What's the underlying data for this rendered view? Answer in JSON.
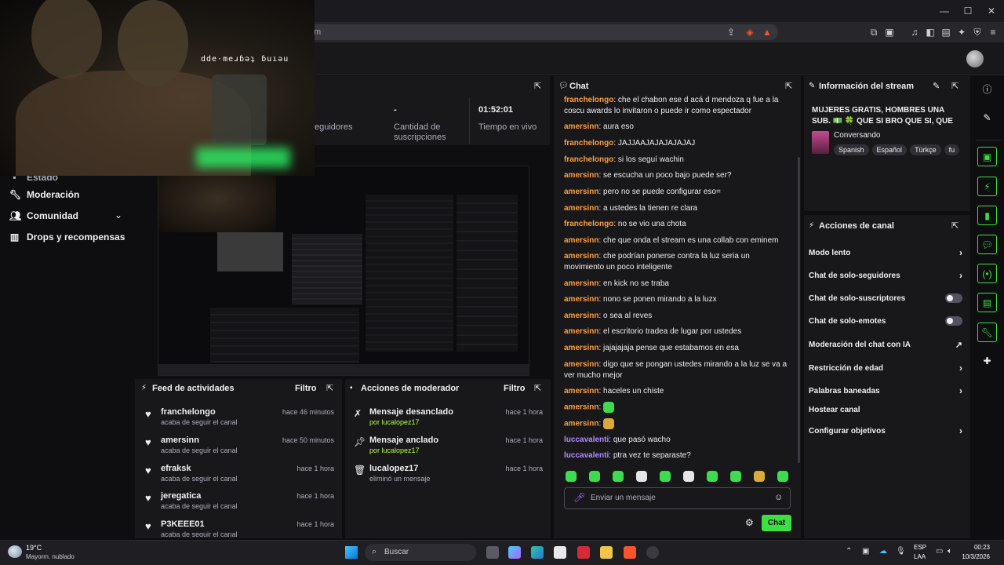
{
  "browser": {
    "url_partial": "m",
    "window_min": "—",
    "window_max": "☐",
    "window_close": "✕"
  },
  "overlay": {
    "text": "dde·meɹɓǝʇ ɓuıǝu"
  },
  "stats": {
    "seguidores_label": "eguidores",
    "subs_value": "-",
    "subs_label": "Cantidad de suscripciones",
    "live_value": "01:52:01",
    "live_label": "Tiempo en vivo"
  },
  "nav": {
    "partial": "Estado",
    "items": [
      {
        "label": "Moderación",
        "icon": "wrench-icon"
      },
      {
        "label": "Comunidad",
        "icon": "community-icon"
      },
      {
        "label": "Drops y recompensas",
        "icon": "drops-icon"
      }
    ]
  },
  "feed": {
    "title": "Feed de actividades",
    "filter": "Filtro",
    "items": [
      {
        "name": "franchelongo",
        "sub": "acaba de seguir el canal",
        "time": "hace 46 minutos"
      },
      {
        "name": "amersinn",
        "sub": "acaba de seguir el canal",
        "time": "hace 50 minutos"
      },
      {
        "name": "efraksk",
        "sub": "acaba de seguir el canal",
        "time": "hace 1 hora"
      },
      {
        "name": "jeregatica",
        "sub": "acaba de seguir el canal",
        "time": "hace 1 hora"
      },
      {
        "name": "P3KEEE01",
        "sub": "acaba de seguir el canal",
        "time": "hace 1 hora"
      }
    ]
  },
  "modactions": {
    "title": "Acciones de moderador",
    "filter": "Filtro",
    "items": [
      {
        "name": "Mensaje desanclado",
        "sub": "por lucalopez17",
        "time": "hace 1 hora"
      },
      {
        "name": "Mensaje anclado",
        "sub": "por lucalopez17",
        "time": "hace 1 hora"
      },
      {
        "name": "lucalopez17",
        "sub": "eliminó un mensaje",
        "time": "hace 1 hora"
      }
    ]
  },
  "chat": {
    "title": "Chat",
    "messages": [
      {
        "user": "franchelongo",
        "text": "che el chabon ese d acá d mendoza q fue a la coscu awards lo invitaron o puede ir como espectador",
        "color": "orange"
      },
      {
        "user": "amersinn",
        "text": "aura eso",
        "color": "orange"
      },
      {
        "user": "franchelongo",
        "text": "JAJJAAJAJAJAJAJAJ",
        "color": "orange"
      },
      {
        "user": "franchelongo",
        "text": "si los seguí wachin",
        "color": "orange"
      },
      {
        "user": "amersinn",
        "text": "se escucha un poco bajo puede ser?",
        "color": "orange"
      },
      {
        "user": "amersinn",
        "text": "pero no se puede configurar eso=",
        "color": "orange"
      },
      {
        "user": "amersinn",
        "text": "a ustedes la tienen re clara",
        "color": "orange"
      },
      {
        "user": "franchelongo",
        "text": "no se vio una chota",
        "color": "orange"
      },
      {
        "user": "amersinn",
        "text": "che que onda el stream es una collab con eminem",
        "color": "orange"
      },
      {
        "user": "amersinn",
        "text": "che podrían ponerse contra la luz seria un movimiento un poco inteligente",
        "color": "orange"
      },
      {
        "user": "amersinn",
        "text": "en kick no se traba",
        "color": "orange"
      },
      {
        "user": "amersinn",
        "text": "nono se ponen mirando a la luzx",
        "color": "orange"
      },
      {
        "user": "amersinn",
        "text": "o sea al reves",
        "color": "orange"
      },
      {
        "user": "amersinn",
        "text": "el escritorio tradea de lugar por ustedes",
        "color": "orange"
      },
      {
        "user": "amersinn",
        "text": "jajajajaja pense que estabamos en esa",
        "color": "orange"
      },
      {
        "user": "amersinn",
        "text": "digo que se pongan ustedes mirando a la luz se va a ver mucho mejor",
        "color": "orange"
      },
      {
        "user": "amersinn",
        "text": "haceles un chiste",
        "color": "orange"
      },
      {
        "user": "amersinn",
        "text": "",
        "color": "orange"
      },
      {
        "user": "amersinn",
        "text": "",
        "color": "orange"
      },
      {
        "user": "luccavalenti",
        "text": "que pasó wacho",
        "color": "purple"
      },
      {
        "user": "luccavalenti",
        "text": "ptra vez te separaste?",
        "color": "purple"
      }
    ],
    "input_placeholder": "Enviar un mensaje",
    "send_label": "Chat"
  },
  "info": {
    "title": "Información del stream",
    "stream_title": "MUJERES GRATIS, HOMBRES UNA SUB. 💵 🍀 QUE SI BRO QUE SI, QUE EL TRIO...",
    "category": "Conversando",
    "tags": [
      "Spanish",
      "Español",
      "Türkçe",
      "fu"
    ]
  },
  "actions": {
    "title": "Acciones de canal",
    "items": [
      {
        "label": "Modo lento",
        "control": "chevron"
      },
      {
        "label": "Chat de solo-seguidores",
        "control": "chevron"
      },
      {
        "label": "Chat de solo-suscriptores",
        "control": "toggle"
      },
      {
        "label": "Chat de solo-emotes",
        "control": "toggle"
      },
      {
        "label": "Moderación del chat con IA",
        "control": "external"
      },
      {
        "label": "Restricción de edad",
        "control": "chevron"
      },
      {
        "label": "Palabras baneadas",
        "control": "chevron"
      },
      {
        "label": "Hostear canal",
        "control": "none"
      },
      {
        "label": "Configurar objetivos",
        "control": "chevron"
      }
    ]
  },
  "taskbar": {
    "weather_temp": "19°C",
    "weather_desc": "Mayorm. nublado",
    "search": "Buscar",
    "lang_top": "ESP",
    "lang_bottom": "LAA",
    "time": "00:23",
    "date": "10/3/2026"
  },
  "colors": {
    "accent": "#3ce040",
    "orange": "#ff9f38",
    "purple": "#b58aff"
  }
}
